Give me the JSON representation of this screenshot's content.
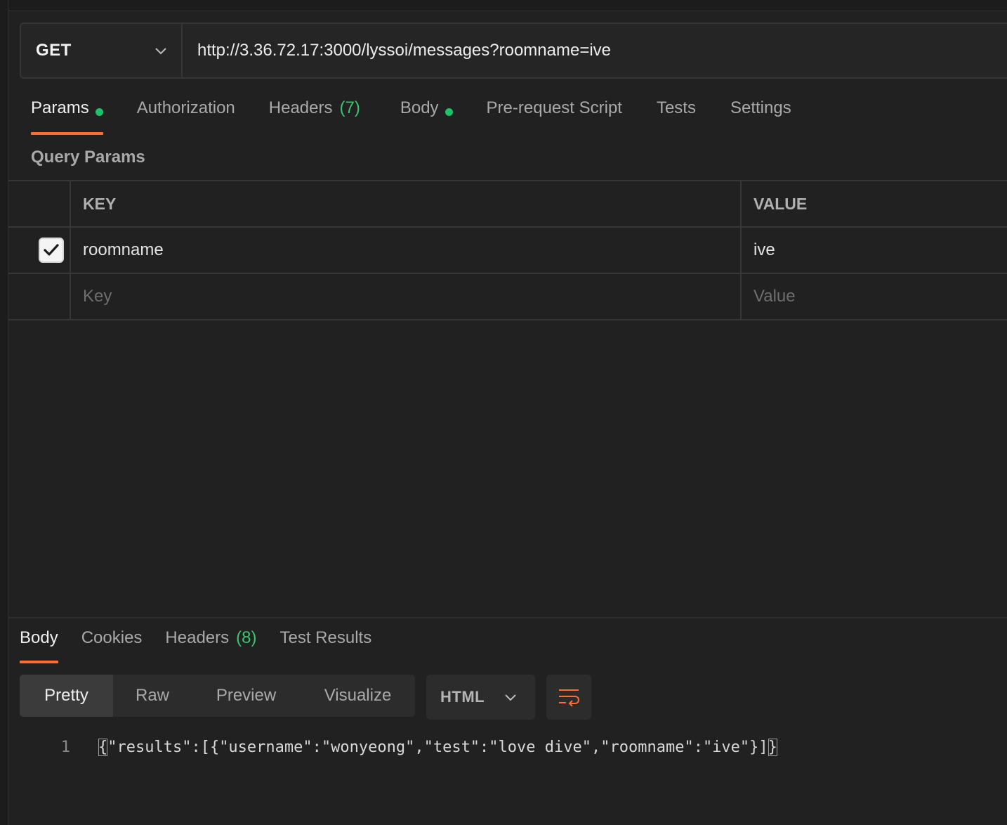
{
  "request": {
    "method": "GET",
    "url": "http://3.36.72.17:3000/lyssoi/messages?roomname=ive"
  },
  "request_tabs": [
    {
      "label": "Params",
      "dot": true,
      "active": true
    },
    {
      "label": "Authorization"
    },
    {
      "label": "Headers",
      "count": "(7)"
    },
    {
      "label": "Body",
      "dot": true
    },
    {
      "label": "Pre-request Script"
    },
    {
      "label": "Tests"
    },
    {
      "label": "Settings"
    }
  ],
  "query_params": {
    "title": "Query Params",
    "headers": {
      "key": "KEY",
      "value": "VALUE"
    },
    "rows": [
      {
        "enabled": true,
        "key": "roomname",
        "value": "ive"
      }
    ],
    "placeholder": {
      "key": "Key",
      "value": "Value"
    }
  },
  "response_tabs": [
    {
      "label": "Body",
      "active": true
    },
    {
      "label": "Cookies"
    },
    {
      "label": "Headers",
      "count": "(8)"
    },
    {
      "label": "Test Results"
    }
  ],
  "view_modes": [
    "Pretty",
    "Raw",
    "Preview",
    "Visualize"
  ],
  "active_view_mode": "Pretty",
  "format": "HTML",
  "body": {
    "line_number": "1",
    "open_brace": "{",
    "content": "\"results\":[{\"username\":\"wonyeong\",\"test\":\"love dive\",\"roomname\":\"ive\"}]",
    "close_brace": "}"
  },
  "colors": {
    "accent": "#ff6c37",
    "status_dot": "#1ec26a",
    "count": "#3cc46e",
    "background": "#212121"
  },
  "icons": {
    "method_dropdown": "chevron-down-icon",
    "format_dropdown": "chevron-down-icon",
    "wrap": "wrap-lines-icon",
    "checkbox": "check-icon"
  }
}
